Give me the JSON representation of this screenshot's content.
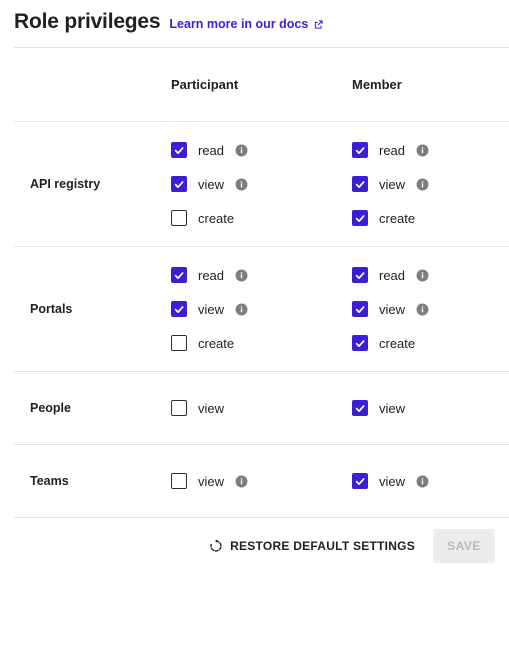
{
  "header": {
    "title": "Role privileges",
    "docs_link_label": "Learn more in our docs",
    "docs_link_icon": "external-link-icon"
  },
  "table": {
    "label_column_header": "",
    "columns": [
      {
        "key": "participant",
        "label": "Participant"
      },
      {
        "key": "member",
        "label": "Member"
      }
    ],
    "rows": [
      {
        "label": "API registry",
        "participant": [
          {
            "label": "read",
            "checked": true,
            "info": true
          },
          {
            "label": "view",
            "checked": true,
            "info": true
          },
          {
            "label": "create",
            "checked": false,
            "info": false
          }
        ],
        "member": [
          {
            "label": "read",
            "checked": true,
            "info": true
          },
          {
            "label": "view",
            "checked": true,
            "info": true
          },
          {
            "label": "create",
            "checked": true,
            "info": false
          }
        ]
      },
      {
        "label": "Portals",
        "participant": [
          {
            "label": "read",
            "checked": true,
            "info": true
          },
          {
            "label": "view",
            "checked": true,
            "info": true
          },
          {
            "label": "create",
            "checked": false,
            "info": false
          }
        ],
        "member": [
          {
            "label": "read",
            "checked": true,
            "info": true
          },
          {
            "label": "view",
            "checked": true,
            "info": true
          },
          {
            "label": "create",
            "checked": true,
            "info": false
          }
        ]
      },
      {
        "label": "People",
        "participant": [
          {
            "label": "view",
            "checked": false,
            "info": false
          }
        ],
        "member": [
          {
            "label": "view",
            "checked": true,
            "info": false
          }
        ]
      },
      {
        "label": "Teams",
        "participant": [
          {
            "label": "view",
            "checked": false,
            "info": true
          }
        ],
        "member": [
          {
            "label": "view",
            "checked": true,
            "info": true
          }
        ]
      }
    ]
  },
  "footer": {
    "restore_label": "RESTORE DEFAULT SETTINGS",
    "restore_icon": "restore-counterclockwise-icon",
    "save_label": "SAVE",
    "save_disabled": true
  },
  "colors": {
    "accent": "#3b1fd6",
    "link": "#3b1fd6",
    "text": "#1f2023",
    "divider": "#e1e2e4",
    "info_icon": "#7b7d82",
    "save_disabled_bg": "#ececed",
    "save_disabled_text": "#b8b9bb"
  }
}
